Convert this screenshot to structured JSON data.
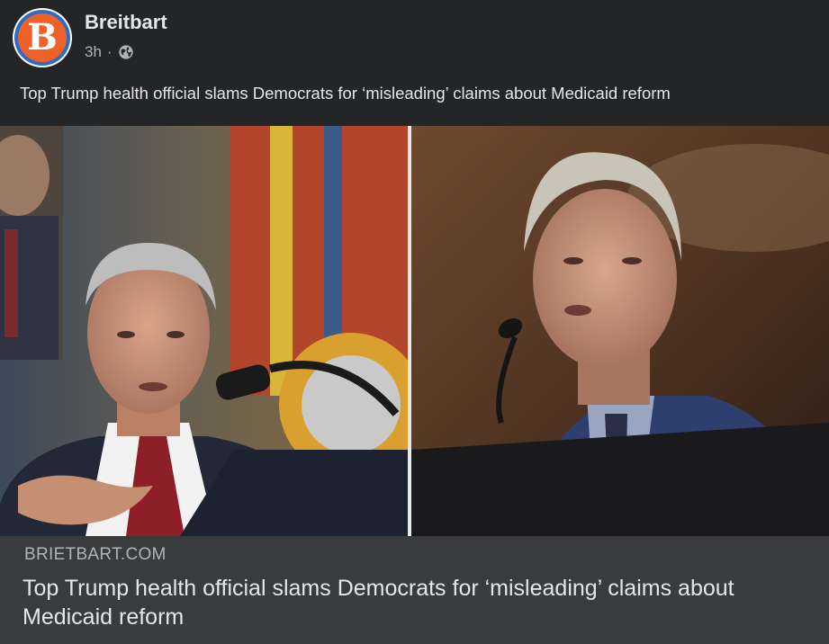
{
  "post": {
    "page_name": "Breitbart",
    "avatar_letter": "B",
    "timestamp": "3h",
    "separator": "·",
    "audience_icon": "globe-icon",
    "caption": "Top Trump health official slams Democrats for ‘misleading’ claims about Medicaid reform"
  },
  "link_preview": {
    "domain": "BRIETBART.COM",
    "title": "Top Trump health official slams Democrats for ‘misleading’ claims about Medicaid reform"
  },
  "colors": {
    "background": "#242526",
    "footer_background": "#3a3b3c",
    "avatar_orange": "#f0612a",
    "avatar_ring_blue": "#2b6cc4",
    "text_primary": "#e4e6eb",
    "text_secondary": "#b0b3b8"
  }
}
